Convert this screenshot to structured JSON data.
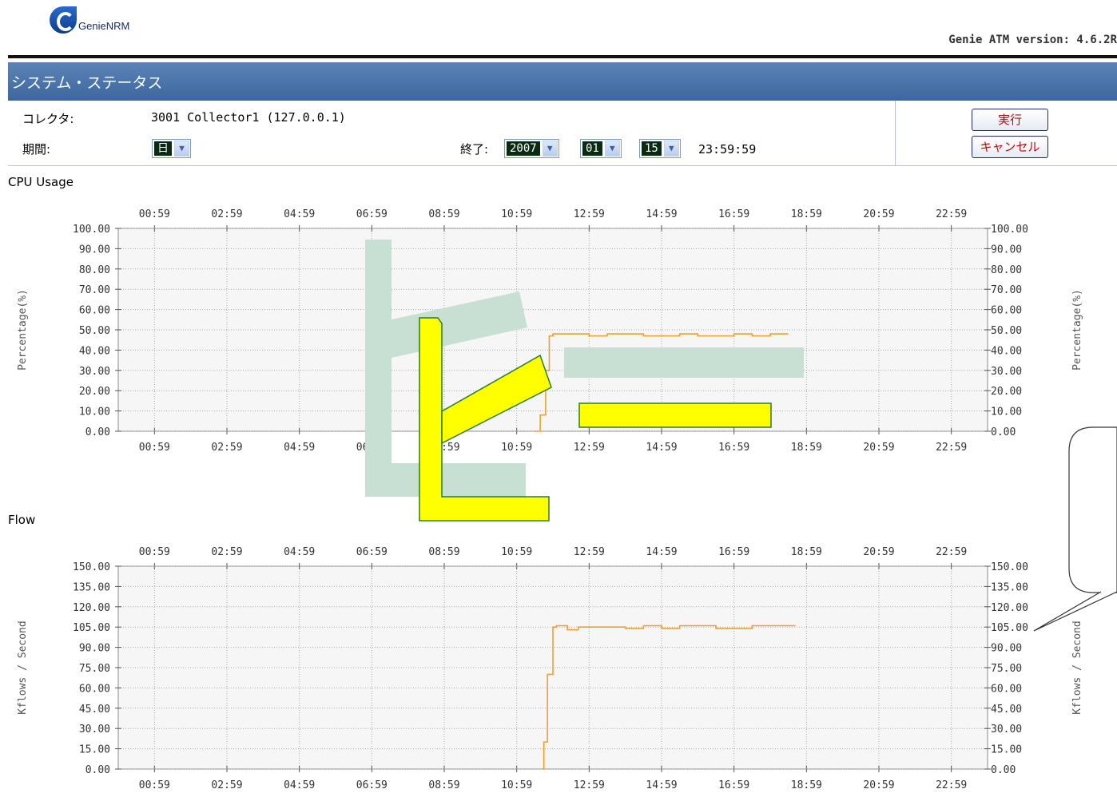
{
  "header": {
    "logo_text": "GenieNRM",
    "version": "Genie ATM version: 4.6.2R"
  },
  "page_title": "システム・ステータス",
  "form": {
    "collector_label": "コレクタ:",
    "collector_value": "3001 Collector1 (127.0.0.1)",
    "period_label": "期間:",
    "period_value": "日",
    "end_label": "終了:",
    "end_year": "2007",
    "end_month": "01",
    "end_day": "15",
    "end_time": "23:59:59",
    "run_button": "実行",
    "cancel_button": "キャンセル"
  },
  "overlay": {
    "big_text": "ピー"
  },
  "colors": {
    "series_line": "#f0a030",
    "title_bar": "#4a72a8",
    "overlay_fill": "#ffff00",
    "overlay_shadow": "#c8dfd4"
  },
  "chart_data": [
    {
      "type": "line",
      "title": "CPU Usage",
      "xlabel": "",
      "ylabel": "Percentage(%)",
      "x_ticks": [
        "00:59",
        "02:59",
        "04:59",
        "06:59",
        "08:59",
        "10:59",
        "12:59",
        "14:59",
        "16:59",
        "18:59",
        "20:59",
        "22:59"
      ],
      "y_ticks": [
        "100.00",
        "90.00",
        "80.00",
        "70.00",
        "60.00",
        "50.00",
        "40.00",
        "30.00",
        "20.00",
        "10.00",
        "0.00"
      ],
      "ylim": [
        0,
        100
      ],
      "grid": true,
      "series": [
        {
          "x": [
            10.5,
            10.65,
            10.8,
            10.9,
            11.0,
            11.2,
            12.0,
            12.5,
            13.0,
            13.5,
            14.0,
            14.5,
            15.0,
            15.5,
            16.0,
            16.5,
            17.0,
            17.5
          ],
          "y": [
            0,
            8,
            30,
            47,
            48,
            48,
            47,
            48,
            48,
            47,
            47,
            48,
            47,
            47,
            48,
            47,
            48,
            48
          ]
        }
      ]
    },
    {
      "type": "line",
      "title": "Flow",
      "xlabel": "",
      "ylabel": "Kflows / Second",
      "x_ticks": [
        "00:59",
        "02:59",
        "04:59",
        "06:59",
        "08:59",
        "10:59",
        "12:59",
        "14:59",
        "16:59",
        "18:59",
        "20:59",
        "22:59"
      ],
      "y_ticks": [
        "150.00",
        "135.00",
        "120.00",
        "105.00",
        "90.00",
        "75.00",
        "60.00",
        "45.00",
        "30.00",
        "15.00",
        "0.00"
      ],
      "ylim": [
        0,
        150
      ],
      "grid": true,
      "series": [
        {
          "x": [
            10.7,
            10.75,
            10.85,
            11.0,
            11.1,
            11.2,
            11.4,
            11.7,
            12.0,
            12.5,
            13.0,
            13.5,
            14.0,
            14.5,
            15.0,
            15.5,
            16.0,
            16.5,
            17.0,
            17.5,
            17.7
          ],
          "y": [
            0,
            20,
            70,
            105,
            106,
            106,
            103,
            105,
            105,
            105,
            104,
            106,
            104,
            106,
            106,
            104,
            104,
            106,
            106,
            106,
            106
          ]
        }
      ]
    }
  ]
}
